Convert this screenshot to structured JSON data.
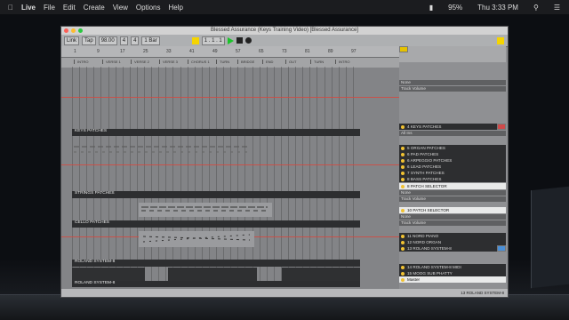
{
  "menubar": {
    "apple_icon": "apple-icon",
    "items": [
      "Live",
      "File",
      "Edit",
      "Create",
      "View",
      "Options",
      "Help"
    ],
    "battery": "95%",
    "clock": "Thu 3:33 PM"
  },
  "window": {
    "title": "Blessed Assurance (Keys Training Video) [Blessed Assurance]"
  },
  "control_bar": {
    "link": "Link",
    "tap": "Tap",
    "tempo": "98.00",
    "sig_num": "4",
    "sig_den": "4",
    "quantize": "1 Bar",
    "position": "1 . 1 . 1"
  },
  "locators": [
    "INTRO",
    "VERSE 1",
    "VERSE 2",
    "VERSE 3",
    "CHORUS 1",
    "TURN",
    "BRIDGE",
    "END",
    "OUT",
    "TURN",
    "INTRO"
  ],
  "ruler_ticks": [
    "1",
    "9",
    "17",
    "25",
    "33",
    "41",
    "49",
    "57",
    "65",
    "73",
    "81",
    "89",
    "97"
  ],
  "tracks": [
    {
      "label": "KEYS PATCHES",
      "name": "4 KEYS PATCHES"
    },
    {
      "label": "STRINGS PATCHES",
      "name": "8 PATCH SELECTOR"
    },
    {
      "label": "CELLO PATCHES",
      "name": "10 PATCH SELECTOR"
    },
    {
      "label": "ROLAND SYSTEM-8",
      "name": "13 ROLAND SYSTEM-8"
    },
    {
      "label": "ROLAND SYSTEM-8",
      "name": "14 ROLAND SYSTEM-8 MIDI"
    }
  ],
  "right_tracks": [
    "5 ORGAN PATCHES",
    "6 PAD PATCHES",
    "6 ARPEGGIO PATCHES",
    "6 LEAD PATCHES",
    "7 SYNTH PATCHES",
    "8 BASS PATCHES",
    "11 NORD PIANO",
    "12 NORD ORGAN",
    "15 MOOG SUB PHATTY"
  ],
  "io": {
    "none": "None",
    "track_volume": "Track Volume",
    "all_ins": "All Ins",
    "master": "Master"
  },
  "bottom": {
    "status": "13 ROLAND SYSTEM-8"
  },
  "colors": {
    "accent": "#f5d400",
    "play": "#1bc42a",
    "record_arm": "#d04a4a",
    "track_header": "#2d2e30"
  }
}
